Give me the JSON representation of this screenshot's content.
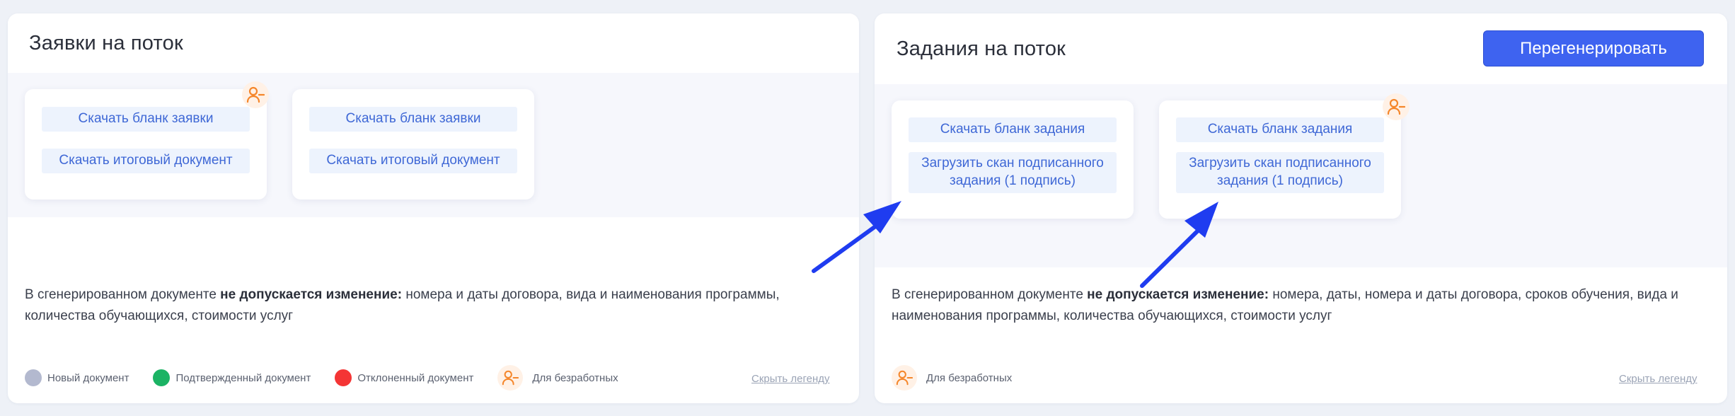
{
  "left_panel": {
    "title": "Заявки на поток",
    "cards": [
      {
        "download_form": "Скачать бланк заявки",
        "download_final": "Скачать итоговый документ",
        "unemployed_badge": true
      },
      {
        "download_form": "Скачать бланк заявки",
        "download_final": "Скачать итоговый документ",
        "unemployed_badge": false
      }
    ],
    "note_prefix": "В сгенерированном документе ",
    "note_bold": "не допускается изменение:",
    "note_rest": " номера и даты договора, вида и наименования программы, количества обучающихся, стоимости услуг",
    "legend": {
      "new": "Новый документ",
      "confirmed": "Подтвержденный документ",
      "rejected": "Отклоненный документ",
      "unemployed": "Для безработных"
    },
    "hide_legend": "Скрыть легенду"
  },
  "right_panel": {
    "title": "Задания на поток",
    "regenerate_button": "Перегенерировать",
    "cards": [
      {
        "download_form": "Скачать бланк задания",
        "upload_scan": "Загрузить скан подписанного задания (1 подпись)",
        "unemployed_badge": false
      },
      {
        "download_form": "Скачать бланк задания",
        "upload_scan": "Загрузить скан подписанного задания (1 подпись)",
        "unemployed_badge": true
      }
    ],
    "note_prefix": "В сгенерированном документе ",
    "note_bold": "не допускается изменение:",
    "note_rest": " номера, даты, номера и даты договора, сроков обучения, вида и наименования программы, количества обучающихся, стоимости услуг",
    "legend": {
      "unemployed": "Для безработных"
    },
    "hide_legend": "Скрыть легенду"
  },
  "colors": {
    "accent": "#3e63f0",
    "link": "#3f68d6",
    "status_new": "#b3b9cf",
    "status_confirmed": "#1bb364",
    "status_rejected": "#f43535",
    "unemployed_icon": "#f5862a",
    "annotation_arrow": "#1f3cf0"
  },
  "icons": {
    "unemployed": "user-minus-icon",
    "annotation": "arrow-icon"
  }
}
